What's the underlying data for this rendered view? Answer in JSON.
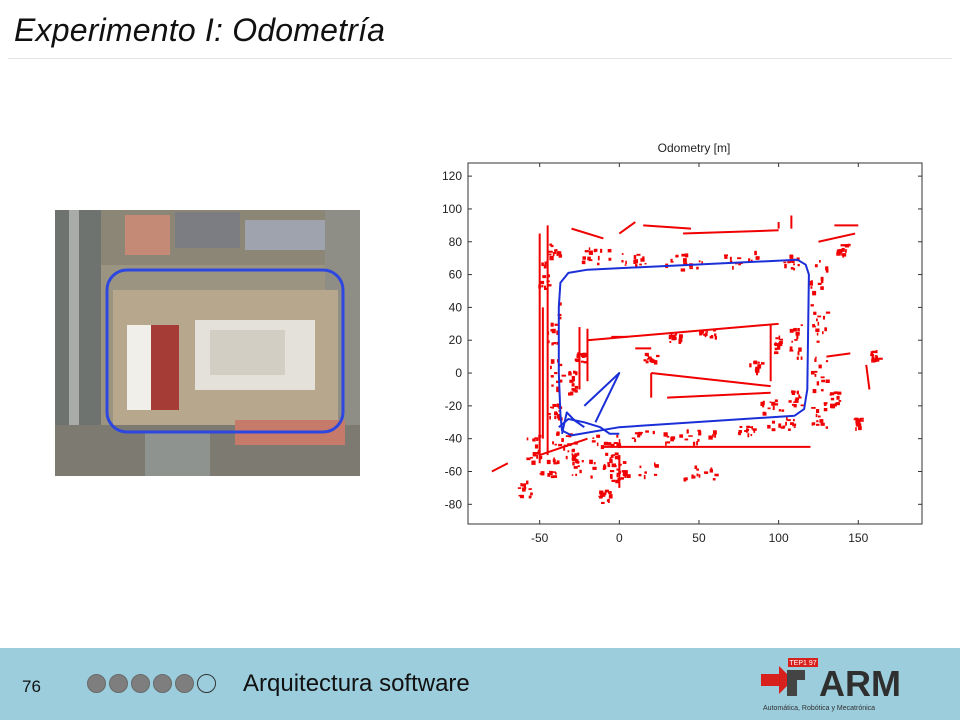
{
  "slide": {
    "title": "Experimento I: Odometría",
    "page_number": "76",
    "footer_label": "Arquitectura software",
    "progress_dots": [
      true,
      true,
      true,
      true,
      true,
      false
    ],
    "colors": {
      "footer_bg": "#9ccddd",
      "trajectory": "#1a2fd8",
      "map_points": "#f00000"
    }
  },
  "logo": {
    "text": "ARM",
    "badge": "TEP1 97",
    "tagline": "Automática, Robótica y Mecatrónica"
  },
  "chart_data": {
    "type": "scatter",
    "title": "Odometry [m]",
    "xlabel": "",
    "ylabel": "",
    "xlim": [
      -95,
      190
    ],
    "ylim": [
      -92,
      128
    ],
    "xticks": [
      -50,
      0,
      50,
      100,
      150
    ],
    "yticks": [
      120,
      100,
      80,
      60,
      40,
      20,
      0,
      -20,
      -40,
      -60,
      -80
    ],
    "grid": false,
    "series": [
      {
        "kind": "line",
        "color": "#1a2fd8",
        "points": [
          [
            -20,
            63
          ],
          [
            112,
            69
          ],
          [
            117,
            66
          ],
          [
            119,
            60
          ],
          [
            118,
            -10
          ],
          [
            116,
            -22
          ],
          [
            110,
            -26
          ],
          [
            0,
            -33
          ],
          [
            -30,
            -38
          ],
          [
            -36,
            -35
          ],
          [
            -37,
            -25
          ],
          [
            -38,
            0
          ],
          [
            -38,
            40
          ],
          [
            -37,
            55
          ],
          [
            -32,
            61
          ],
          [
            -20,
            63
          ]
        ]
      },
      {
        "kind": "line",
        "color": "#1a2fd8",
        "points": [
          [
            -38,
            -33
          ],
          [
            -32,
            -28
          ],
          [
            -22,
            -30
          ],
          [
            -12,
            -33
          ],
          [
            -6,
            -37
          ],
          [
            0,
            -37
          ]
        ]
      },
      {
        "kind": "line",
        "color": "#1a2fd8",
        "points": [
          [
            -22,
            -20
          ],
          [
            0,
            0
          ],
          [
            -15,
            -30
          ]
        ]
      },
      {
        "kind": "line",
        "color": "#1a2fd8",
        "points": [
          [
            -36,
            -37
          ],
          [
            -33,
            -24
          ],
          [
            -28,
            -29
          ],
          [
            -22,
            -33
          ]
        ]
      },
      {
        "kind": "segments",
        "color": "#f00000",
        "segments": [
          [
            [
              -45,
              90
            ],
            [
              -45,
              -50
            ]
          ],
          [
            [
              -50,
              85
            ],
            [
              -50,
              -55
            ]
          ],
          [
            [
              -48,
              40
            ],
            [
              -48,
              -40
            ]
          ],
          [
            [
              -30,
              88
            ],
            [
              -10,
              82
            ]
          ],
          [
            [
              15,
              90
            ],
            [
              45,
              88
            ]
          ],
          [
            [
              0,
              85
            ],
            [
              10,
              92
            ]
          ],
          [
            [
              40,
              85
            ],
            [
              100,
              87
            ]
          ],
          [
            [
              100,
              92
            ],
            [
              100,
              88
            ]
          ],
          [
            [
              -20,
              20
            ],
            [
              100,
              30
            ]
          ],
          [
            [
              -25,
              28
            ],
            [
              -25,
              -10
            ]
          ],
          [
            [
              -20,
              27
            ],
            [
              -20,
              -5
            ]
          ],
          [
            [
              20,
              0
            ],
            [
              95,
              -8
            ]
          ],
          [
            [
              95,
              30
            ],
            [
              95,
              -5
            ]
          ],
          [
            [
              20,
              0
            ],
            [
              20,
              -15
            ]
          ],
          [
            [
              30,
              -15
            ],
            [
              95,
              -12
            ]
          ],
          [
            [
              -10,
              -45
            ],
            [
              120,
              -45
            ]
          ],
          [
            [
              -50,
              -50
            ],
            [
              -20,
              -40
            ]
          ],
          [
            [
              108,
              88
            ],
            [
              108,
              96
            ]
          ],
          [
            [
              125,
              80
            ],
            [
              148,
              85
            ]
          ],
          [
            [
              135,
              90
            ],
            [
              150,
              90
            ]
          ],
          [
            [
              -5,
              22
            ],
            [
              5,
              22
            ]
          ],
          [
            [
              10,
              15
            ],
            [
              20,
              15
            ]
          ],
          [
            [
              130,
              10
            ],
            [
              145,
              12
            ]
          ],
          [
            [
              155,
              5
            ],
            [
              157,
              -10
            ]
          ],
          [
            [
              -80,
              -60
            ],
            [
              -70,
              -55
            ]
          ],
          [
            [
              0,
              -70
            ],
            [
              0,
              -50
            ]
          ]
        ]
      },
      {
        "kind": "clusters",
        "color": "#f00000",
        "note_free": true,
        "clusters": [
          [
            -40,
            75,
            12,
            8
          ],
          [
            -15,
            72,
            18,
            10
          ],
          [
            10,
            70,
            20,
            8
          ],
          [
            40,
            68,
            25,
            10
          ],
          [
            75,
            70,
            25,
            10
          ],
          [
            108,
            68,
            10,
            10
          ],
          [
            125,
            60,
            12,
            20
          ],
          [
            125,
            30,
            10,
            25
          ],
          [
            125,
            0,
            10,
            20
          ],
          [
            125,
            -25,
            10,
            15
          ],
          [
            110,
            20,
            8,
            20
          ],
          [
            110,
            -15,
            8,
            10
          ],
          [
            100,
            -30,
            20,
            8
          ],
          [
            80,
            -35,
            20,
            6
          ],
          [
            50,
            -38,
            25,
            8
          ],
          [
            20,
            -38,
            25,
            8
          ],
          [
            -10,
            -40,
            20,
            8
          ],
          [
            -35,
            -40,
            15,
            10
          ],
          [
            -45,
            -55,
            12,
            15
          ],
          [
            -20,
            -58,
            20,
            12
          ],
          [
            10,
            -58,
            25,
            10
          ],
          [
            50,
            -60,
            20,
            8
          ],
          [
            -42,
            30,
            8,
            30
          ],
          [
            -40,
            0,
            8,
            20
          ],
          [
            -42,
            -20,
            8,
            15
          ],
          [
            -55,
            -45,
            10,
            20
          ],
          [
            -60,
            -70,
            8,
            10
          ],
          [
            -10,
            -75,
            8,
            8
          ],
          [
            -25,
            10,
            6,
            6
          ],
          [
            20,
            10,
            10,
            5
          ],
          [
            35,
            22,
            8,
            5
          ],
          [
            55,
            25,
            10,
            5
          ],
          [
            85,
            5,
            8,
            8
          ],
          [
            98,
            18,
            6,
            10
          ],
          [
            135,
            -15,
            6,
            8
          ],
          [
            150,
            -30,
            6,
            6
          ],
          [
            160,
            10,
            6,
            8
          ],
          [
            -30,
            -50,
            10,
            8
          ],
          [
            -5,
            -52,
            10,
            8
          ],
          [
            -48,
            60,
            6,
            18
          ],
          [
            -30,
            -5,
            5,
            15
          ],
          [
            95,
            -20,
            15,
            8
          ],
          [
            140,
            75,
            8,
            8
          ],
          [
            0,
            -62,
            12,
            8
          ]
        ]
      }
    ]
  }
}
